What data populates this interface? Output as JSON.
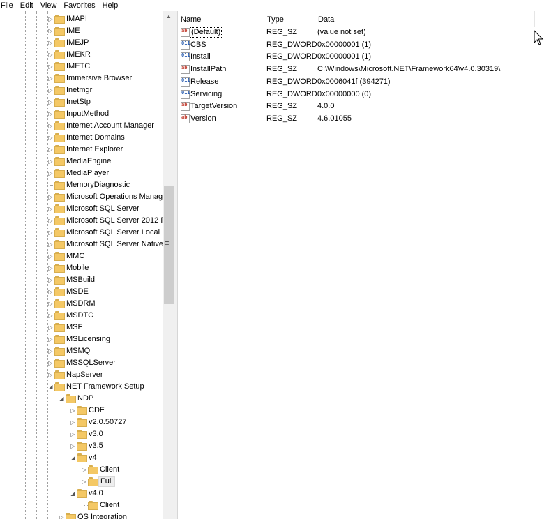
{
  "menubar": {
    "items": [
      "File",
      "Edit",
      "View",
      "Favorites",
      "Help"
    ]
  },
  "tree": {
    "items": [
      {
        "label": "IMAPI",
        "level": 0,
        "exp": "collapsed"
      },
      {
        "label": "IME",
        "level": 0,
        "exp": "collapsed"
      },
      {
        "label": "IMEJP",
        "level": 0,
        "exp": "collapsed"
      },
      {
        "label": "IMEKR",
        "level": 0,
        "exp": "collapsed"
      },
      {
        "label": "IMETC",
        "level": 0,
        "exp": "collapsed"
      },
      {
        "label": "Immersive Browser",
        "level": 0,
        "exp": "collapsed"
      },
      {
        "label": "Inetmgr",
        "level": 0,
        "exp": "collapsed"
      },
      {
        "label": "InetStp",
        "level": 0,
        "exp": "collapsed"
      },
      {
        "label": "InputMethod",
        "level": 0,
        "exp": "collapsed"
      },
      {
        "label": "Internet Account Manager",
        "level": 0,
        "exp": "collapsed"
      },
      {
        "label": "Internet Domains",
        "level": 0,
        "exp": "collapsed"
      },
      {
        "label": "Internet Explorer",
        "level": 0,
        "exp": "collapsed"
      },
      {
        "label": "MediaEngine",
        "level": 0,
        "exp": "collapsed"
      },
      {
        "label": "MediaPlayer",
        "level": 0,
        "exp": "collapsed"
      },
      {
        "label": "MemoryDiagnostic",
        "level": 0,
        "exp": "none"
      },
      {
        "label": "Microsoft Operations Manag",
        "level": 0,
        "exp": "collapsed"
      },
      {
        "label": "Microsoft SQL Server",
        "level": 0,
        "exp": "collapsed"
      },
      {
        "label": "Microsoft SQL Server 2012 R",
        "level": 0,
        "exp": "collapsed"
      },
      {
        "label": "Microsoft SQL Server Local D",
        "level": 0,
        "exp": "collapsed"
      },
      {
        "label": "Microsoft SQL Server Native (",
        "level": 0,
        "exp": "collapsed"
      },
      {
        "label": "MMC",
        "level": 0,
        "exp": "collapsed"
      },
      {
        "label": "Mobile",
        "level": 0,
        "exp": "collapsed"
      },
      {
        "label": "MSBuild",
        "level": 0,
        "exp": "collapsed"
      },
      {
        "label": "MSDE",
        "level": 0,
        "exp": "collapsed"
      },
      {
        "label": "MSDRM",
        "level": 0,
        "exp": "collapsed"
      },
      {
        "label": "MSDTC",
        "level": 0,
        "exp": "collapsed"
      },
      {
        "label": "MSF",
        "level": 0,
        "exp": "collapsed"
      },
      {
        "label": "MSLicensing",
        "level": 0,
        "exp": "collapsed"
      },
      {
        "label": "MSMQ",
        "level": 0,
        "exp": "collapsed"
      },
      {
        "label": "MSSQLServer",
        "level": 0,
        "exp": "collapsed"
      },
      {
        "label": "NapServer",
        "level": 0,
        "exp": "collapsed"
      },
      {
        "label": "NET Framework Setup",
        "level": 0,
        "exp": "expanded"
      },
      {
        "label": "NDP",
        "level": 1,
        "exp": "expanded"
      },
      {
        "label": "CDF",
        "level": 2,
        "exp": "collapsed"
      },
      {
        "label": "v2.0.50727",
        "level": 2,
        "exp": "collapsed"
      },
      {
        "label": "v3.0",
        "level": 2,
        "exp": "collapsed"
      },
      {
        "label": "v3.5",
        "level": 2,
        "exp": "collapsed"
      },
      {
        "label": "v4",
        "level": 2,
        "exp": "expanded"
      },
      {
        "label": "Client",
        "level": 3,
        "exp": "collapsed"
      },
      {
        "label": "Full",
        "level": 3,
        "exp": "collapsed",
        "selected": true
      },
      {
        "label": "v4.0",
        "level": 2,
        "exp": "expanded"
      },
      {
        "label": "Client",
        "level": 3,
        "exp": "none"
      },
      {
        "label": "OS Integration",
        "level": 1,
        "exp": "collapsed"
      }
    ]
  },
  "list": {
    "columns": [
      "Name",
      "Type",
      "Data"
    ],
    "rows": [
      {
        "icon": "string-value-icon",
        "kind": "sz",
        "name": "(Default)",
        "type": "REG_SZ",
        "data": "(value not set)",
        "focused": true
      },
      {
        "icon": "dword-value-icon",
        "kind": "dw",
        "name": "CBS",
        "type": "REG_DWORD",
        "data": "0x00000001 (1)"
      },
      {
        "icon": "dword-value-icon",
        "kind": "dw",
        "name": "Install",
        "type": "REG_DWORD",
        "data": "0x00000001 (1)"
      },
      {
        "icon": "string-value-icon",
        "kind": "sz",
        "name": "InstallPath",
        "type": "REG_SZ",
        "data": "C:\\Windows\\Microsoft.NET\\Framework64\\v4.0.30319\\"
      },
      {
        "icon": "dword-value-icon",
        "kind": "dw",
        "name": "Release",
        "type": "REG_DWORD",
        "data": "0x0006041f (394271)"
      },
      {
        "icon": "dword-value-icon",
        "kind": "dw",
        "name": "Servicing",
        "type": "REG_DWORD",
        "data": "0x00000000 (0)"
      },
      {
        "icon": "string-value-icon",
        "kind": "sz",
        "name": "TargetVersion",
        "type": "REG_SZ",
        "data": "4.0.0"
      },
      {
        "icon": "string-value-icon",
        "kind": "sz",
        "name": "Version",
        "type": "REG_SZ",
        "data": "4.6.01055"
      }
    ]
  },
  "colors": {
    "folder": "#f4c865",
    "selection": "#eeeeee",
    "scrollbar_track": "#f0f0f0",
    "scrollbar_thumb": "#cdcdcd"
  }
}
